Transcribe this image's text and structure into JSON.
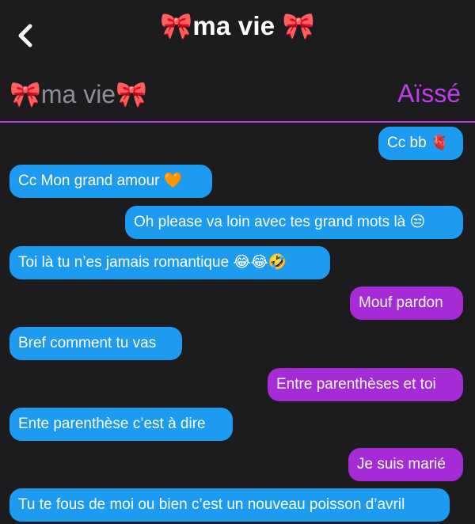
{
  "header": {
    "title": "🎀ma vie 🎀",
    "back_icon": "chevron-left-icon"
  },
  "participants": {
    "left_name": "🎀ma vie🎀",
    "right_name": "Aïssé"
  },
  "colors": {
    "background": "#1c1c1e",
    "blue_bubble": "#1d9bf0",
    "purple_bubble": "#a52bd6",
    "accent_purple": "#c13cf0",
    "muted_text": "#8e8e93"
  },
  "messages": [
    {
      "side": "right",
      "color": "blue",
      "text": "Cc bb 🫀"
    },
    {
      "side": "left",
      "color": "blue",
      "text": "Cc Mon grand amour 🧡"
    },
    {
      "side": "right",
      "color": "blue",
      "text": "Oh please va loin avec tes grand mots là 😒"
    },
    {
      "side": "left",
      "color": "blue",
      "text": "Toi là tu n’es jamais romantique 😂😂🤣"
    },
    {
      "side": "right",
      "color": "purple",
      "text": "Mouf pardon"
    },
    {
      "side": "left",
      "color": "blue",
      "text": "Bref comment tu vas"
    },
    {
      "side": "right",
      "color": "purple",
      "text": "Entre parenthèses et toi"
    },
    {
      "side": "left",
      "color": "blue",
      "text": "Ente parenthèse c’est à dire"
    },
    {
      "side": "right",
      "color": "purple",
      "text": "Je suis marié"
    },
    {
      "side": "left",
      "color": "blue",
      "text": "Tu te fous de moi ou bien c’est un nouveau poisson d’avril"
    }
  ]
}
